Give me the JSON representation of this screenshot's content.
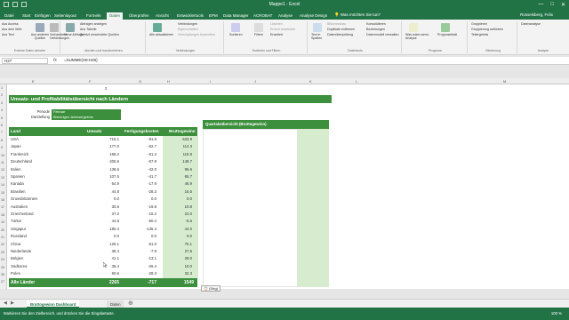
{
  "window": {
    "title": "Mappe1 - Excel",
    "minimize": "—",
    "restore": "□",
    "close": "✕"
  },
  "ribbon_tabs": [
    "Datei",
    "Start",
    "Einfügen",
    "Seitenlayout",
    "Formeln",
    "Daten",
    "Überprüfen",
    "Ansicht",
    "Entwicklertools",
    "EPM",
    "Data Manager",
    "ACROBAT",
    "Analyse",
    "Analyse Design"
  ],
  "active_tab_index": 5,
  "tell_me": "Was möchten Sie tun?",
  "user": "Rüsselsberg, Felix",
  "ribbon_groups": {
    "g1": {
      "name": "Externe Daten abrufen",
      "items": [
        "Aus Access",
        "Aus dem Web",
        "Aus Text",
        "Aus anderen Quellen",
        "Vorhandene Verbindungen"
      ]
    },
    "g2": {
      "name": "Abrufen und transformieren",
      "items": [
        "Neue Abfrage",
        "Abfragen anzeigen",
        "Aus Tabelle",
        "Zuletzt verwendete Quellen"
      ]
    },
    "g3": {
      "name": "Verbindungen",
      "items": [
        "Alle aktualisieren",
        "Verbindungen",
        "Eigenschaften",
        "Verknüpfungen bearbeiten"
      ]
    },
    "g4": {
      "name": "Sortieren und Filtern",
      "items": [
        "Sortieren",
        "Filtern",
        "Löschen",
        "Erneut anwenden",
        "Erweitert"
      ]
    },
    "g5": {
      "name": "Datentools",
      "items": [
        "Text in Spalten",
        "Blitzvorschau",
        "Duplikate entfernen",
        "Datenüberprüfung",
        "Konsolidieren",
        "Beziehungen",
        "Datenmodell verwalten"
      ]
    },
    "g6": {
      "name": "Prognose",
      "items": [
        "Was-wäre-wenn-Analyse",
        "Prognoseblatt"
      ]
    },
    "g7": {
      "name": "Gliederung",
      "items": [
        "Gruppieren",
        "Gruppierung aufheben",
        "Teilergebnis"
      ]
    },
    "g8": {
      "name": "Analyse",
      "items": [
        "Datenanalyse"
      ]
    }
  },
  "formula_bar": {
    "name_box": "H27",
    "fx": "fx",
    "formula": "=SUMME(H8:H26)"
  },
  "columns": [
    "E",
    "F",
    "G",
    "H",
    "I",
    "J",
    "K",
    "L",
    "M"
  ],
  "rows": [
    "1",
    "2",
    "3",
    "4",
    "5",
    "6",
    "7",
    "8",
    "9",
    "10",
    "11",
    "12",
    "13",
    "14",
    "15",
    "16",
    "17",
    "18",
    "19",
    "20",
    "21",
    "22",
    "23",
    "24",
    "25",
    "26",
    "27"
  ],
  "sheet": {
    "cell_c2": "2",
    "title": "Umsatz- und Profitabilitätsübersicht nach Ländern",
    "filters": [
      {
        "label": "Periode",
        "value": "Februar"
      },
      {
        "label": "Darstellung",
        "value": "Bisheriges Jahresergebnis"
      }
    ],
    "table_headers": [
      "Land",
      "Umsatz",
      "Fertigungskosten",
      "Bruttogewinn"
    ],
    "countries": [
      {
        "land": "USA",
        "umsatz": "715.1",
        "kosten": "-81.6",
        "gewinn": "633.9"
      },
      {
        "land": "Japan",
        "umsatz": "177.0",
        "kosten": "-62.7",
        "gewinn": "114.3"
      },
      {
        "land": "Frankreich",
        "umsatz": "168.2",
        "kosten": "-51.2",
        "gewinn": "116.9"
      },
      {
        "land": "Deutschland",
        "umsatz": "206.6",
        "kosten": "-57.9",
        "gewinn": "148.7"
      },
      {
        "land": "Italien",
        "umsatz": "138.6",
        "kosten": "-42.0",
        "gewinn": "96.6"
      },
      {
        "land": "Spanien",
        "umsatz": "107.5",
        "kosten": "-41.7",
        "gewinn": "65.7"
      },
      {
        "land": "Kanada",
        "umsatz": "64.9",
        "kosten": "-17.9",
        "gewinn": "46.9"
      },
      {
        "land": "Brasilien",
        "umsatz": "44.8",
        "kosten": "-28.3",
        "gewinn": "16.5"
      },
      {
        "land": "Grossbritannien",
        "umsatz": "0.0",
        "kosten": "0.0",
        "gewinn": "0.0"
      },
      {
        "land": "Australien",
        "umsatz": "30.6",
        "kosten": "-19.8",
        "gewinn": "10.8"
      },
      {
        "land": "Griechenland",
        "umsatz": "37.2",
        "kosten": "-15.2",
        "gewinn": "22.0"
      },
      {
        "land": "Türkei",
        "umsatz": "44.8",
        "kosten": "-50.4",
        "gewinn": "-5.6"
      },
      {
        "land": "Singapur",
        "umsatz": "180.4",
        "kosten": "-136.4",
        "gewinn": "44.0"
      },
      {
        "land": "Russland",
        "umsatz": "0.0",
        "kosten": "0.0",
        "gewinn": "0.0"
      },
      {
        "land": "China",
        "umsatz": "126.1",
        "kosten": "-51.0",
        "gewinn": "75.1"
      },
      {
        "land": "Niederlande",
        "umsatz": "35.4",
        "kosten": "-7.9",
        "gewinn": "27.5"
      },
      {
        "land": "Belgien",
        "umsatz": "41.1",
        "kosten": "-13.1",
        "gewinn": "28.0"
      },
      {
        "land": "Südkorea",
        "umsatz": "36.4",
        "kosten": "-26.4",
        "gewinn": "10.0"
      },
      {
        "land": "Polen",
        "umsatz": "60.6",
        "kosten": "-28.3",
        "gewinn": "32.3"
      }
    ],
    "total": {
      "label": "Alle Länder",
      "umsatz": "2265",
      "kosten": "-717",
      "gewinn": "1549"
    },
    "quarterly_title": "Quartalsübersicht (Bruttogewinn)",
    "paste_options": "(Strg)"
  },
  "sheet_tabs": [
    "Bruttogewinn Dashboard",
    "Daten"
  ],
  "status": {
    "message": "Markieren Sie den Zielbereich, und drücken Sie die Eingabetaste.",
    "zoom": "100 %"
  },
  "colors": {
    "excel_green": "#217346",
    "table_green": "#3c8f3c",
    "light_green": "#d7eccf"
  }
}
